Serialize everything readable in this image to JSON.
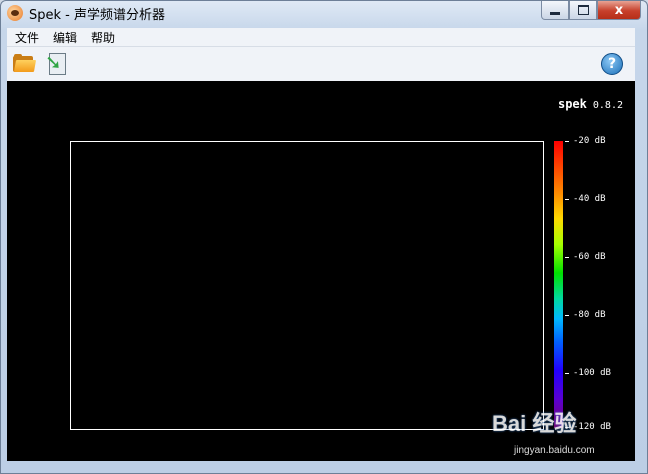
{
  "window": {
    "title": "Spek - 声学频谱分析器",
    "controls": {
      "minimize_icon": "minimize-icon",
      "maximize_icon": "maximize-icon",
      "close_label": "x"
    }
  },
  "menubar": {
    "items": [
      {
        "label": "文件"
      },
      {
        "label": "编辑"
      },
      {
        "label": "帮助"
      }
    ]
  },
  "toolbar": {
    "open_icon": "folder-open-icon",
    "save_icon": "save-icon",
    "help_label": "?"
  },
  "canvas": {
    "brand_name": "spek",
    "version": "0.8.2",
    "scale_labels": [
      "-20 dB",
      "-40 dB",
      "-60 dB",
      "-80 dB",
      "-100 dB",
      "-120 dB"
    ]
  },
  "watermark": {
    "text": "Bai 经验",
    "url": "jingyan.baidu.com"
  },
  "colors": {
    "background": "#000000",
    "scale_top": "#ff0000",
    "scale_bottom": "#7a0070"
  }
}
